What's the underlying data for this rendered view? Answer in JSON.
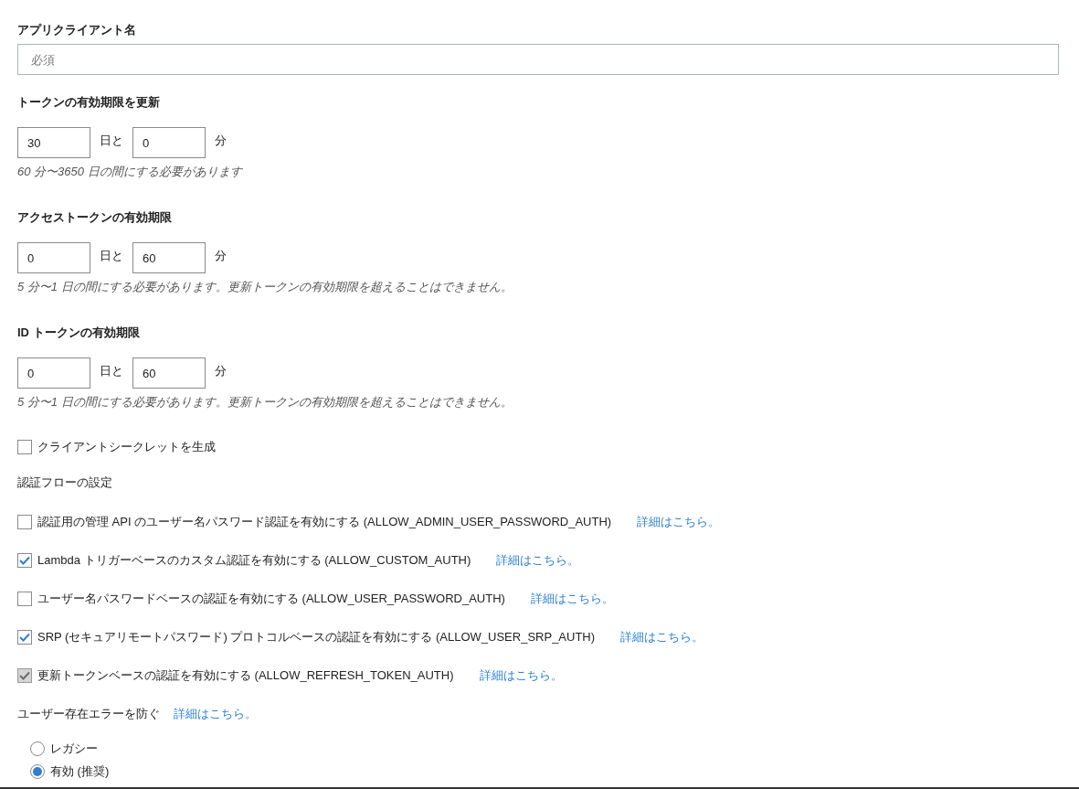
{
  "app_client_name": {
    "label": "アプリクライアント名",
    "placeholder": "必須"
  },
  "token_settings": [
    {
      "label": "トークンの有効期限を更新",
      "days": "30",
      "days_unit": "日と",
      "minutes": "0",
      "minutes_unit": "分",
      "hint": "60 分〜3650 日の間にする必要があります"
    },
    {
      "label": "アクセストークンの有効期限",
      "days": "0",
      "days_unit": "日と",
      "minutes": "60",
      "minutes_unit": "分",
      "hint": "5 分〜1 日の間にする必要があります。更新トークンの有効期限を超えることはできません。"
    },
    {
      "label": "ID トークンの有効期限",
      "days": "0",
      "days_unit": "日と",
      "minutes": "60",
      "minutes_unit": "分",
      "hint": "5 分〜1 日の間にする必要があります。更新トークンの有効期限を超えることはできません。"
    }
  ],
  "generate_client_secret": {
    "label": "クライアントシークレットを生成",
    "checked": false
  },
  "auth_flows": {
    "title": "認証フローの設定",
    "items": [
      {
        "label": "認証用の管理 API のユーザー名パスワード認証を有効にする (ALLOW_ADMIN_USER_PASSWORD_AUTH)",
        "checked": false,
        "disabled": false,
        "link": "詳細はこちら。"
      },
      {
        "label": "Lambda トリガーベースのカスタム認証を有効にする (ALLOW_CUSTOM_AUTH)",
        "checked": true,
        "disabled": false,
        "link": "詳細はこちら。"
      },
      {
        "label": "ユーザー名パスワードベースの認証を有効にする (ALLOW_USER_PASSWORD_AUTH)",
        "checked": false,
        "disabled": false,
        "link": "詳細はこちら。"
      },
      {
        "label": "SRP (セキュアリモートパスワード) プロトコルベースの認証を有効にする (ALLOW_USER_SRP_AUTH)",
        "checked": true,
        "disabled": false,
        "link": "詳細はこちら。"
      },
      {
        "label": "更新トークンベースの認証を有効にする (ALLOW_REFRESH_TOKEN_AUTH)",
        "checked": true,
        "disabled": true,
        "link": "詳細はこちら。"
      }
    ]
  },
  "prevent_user_existence_errors": {
    "label": "ユーザー存在エラーを防ぐ",
    "link": "詳細はこちら。",
    "options": [
      {
        "label": "レガシー",
        "selected": false
      },
      {
        "label": "有効 (推奨)",
        "selected": true
      }
    ]
  }
}
